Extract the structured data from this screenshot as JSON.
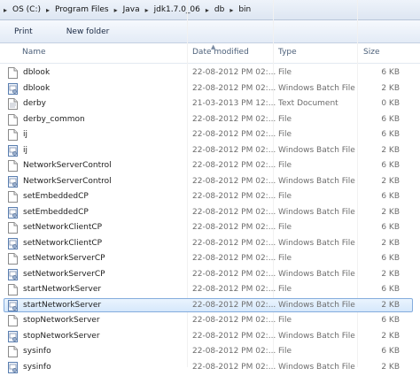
{
  "address": {
    "crumbs": [
      "OS (C:)",
      "Program Files",
      "Java",
      "jdk1.7.0_06",
      "db",
      "bin"
    ]
  },
  "toolbar": {
    "print_label": "Print",
    "new_folder_label": "New folder"
  },
  "columns": {
    "name": "Name",
    "date": "Date modified",
    "type": "Type",
    "size": "Size"
  },
  "files": [
    {
      "name": "dblook",
      "date": "22-08-2012 PM 02:...",
      "type": "File",
      "size": "6 KB",
      "icon": "file-icon"
    },
    {
      "name": "dblook",
      "date": "22-08-2012 PM 02:...",
      "type": "Windows Batch File",
      "size": "2 KB",
      "icon": "batch-file-icon"
    },
    {
      "name": "derby",
      "date": "21-03-2013 PM 12:...",
      "type": "Text Document",
      "size": "0 KB",
      "icon": "text-document-icon"
    },
    {
      "name": "derby_common",
      "date": "22-08-2012 PM 02:...",
      "type": "File",
      "size": "6 KB",
      "icon": "file-icon"
    },
    {
      "name": "ij",
      "date": "22-08-2012 PM 02:...",
      "type": "File",
      "size": "6 KB",
      "icon": "file-icon"
    },
    {
      "name": "ij",
      "date": "22-08-2012 PM 02:...",
      "type": "Windows Batch File",
      "size": "2 KB",
      "icon": "batch-file-icon"
    },
    {
      "name": "NetworkServerControl",
      "date": "22-08-2012 PM 02:...",
      "type": "File",
      "size": "6 KB",
      "icon": "file-icon"
    },
    {
      "name": "NetworkServerControl",
      "date": "22-08-2012 PM 02:...",
      "type": "Windows Batch File",
      "size": "2 KB",
      "icon": "batch-file-icon"
    },
    {
      "name": "setEmbeddedCP",
      "date": "22-08-2012 PM 02:...",
      "type": "File",
      "size": "6 KB",
      "icon": "file-icon"
    },
    {
      "name": "setEmbeddedCP",
      "date": "22-08-2012 PM 02:...",
      "type": "Windows Batch File",
      "size": "2 KB",
      "icon": "batch-file-icon"
    },
    {
      "name": "setNetworkClientCP",
      "date": "22-08-2012 PM 02:...",
      "type": "File",
      "size": "6 KB",
      "icon": "file-icon"
    },
    {
      "name": "setNetworkClientCP",
      "date": "22-08-2012 PM 02:...",
      "type": "Windows Batch File",
      "size": "2 KB",
      "icon": "batch-file-icon"
    },
    {
      "name": "setNetworkServerCP",
      "date": "22-08-2012 PM 02:...",
      "type": "File",
      "size": "6 KB",
      "icon": "file-icon"
    },
    {
      "name": "setNetworkServerCP",
      "date": "22-08-2012 PM 02:...",
      "type": "Windows Batch File",
      "size": "2 KB",
      "icon": "batch-file-icon"
    },
    {
      "name": "startNetworkServer",
      "date": "22-08-2012 PM 02:...",
      "type": "File",
      "size": "6 KB",
      "icon": "file-icon"
    },
    {
      "name": "startNetworkServer",
      "date": "22-08-2012 PM 02:...",
      "type": "Windows Batch File",
      "size": "2 KB",
      "icon": "batch-file-icon",
      "selected": true
    },
    {
      "name": "stopNetworkServer",
      "date": "22-08-2012 PM 02:...",
      "type": "File",
      "size": "6 KB",
      "icon": "file-icon"
    },
    {
      "name": "stopNetworkServer",
      "date": "22-08-2012 PM 02:...",
      "type": "Windows Batch File",
      "size": "2 KB",
      "icon": "batch-file-icon"
    },
    {
      "name": "sysinfo",
      "date": "22-08-2012 PM 02:...",
      "type": "File",
      "size": "6 KB",
      "icon": "file-icon"
    },
    {
      "name": "sysinfo",
      "date": "22-08-2012 PM 02:...",
      "type": "Windows Batch File",
      "size": "2 KB",
      "icon": "batch-file-icon"
    }
  ],
  "colors": {
    "selection_border": "#84acdd",
    "selection_fill": "#d6e8fb",
    "header_text": "#4c607a",
    "detail_text": "#6d6d6d"
  }
}
